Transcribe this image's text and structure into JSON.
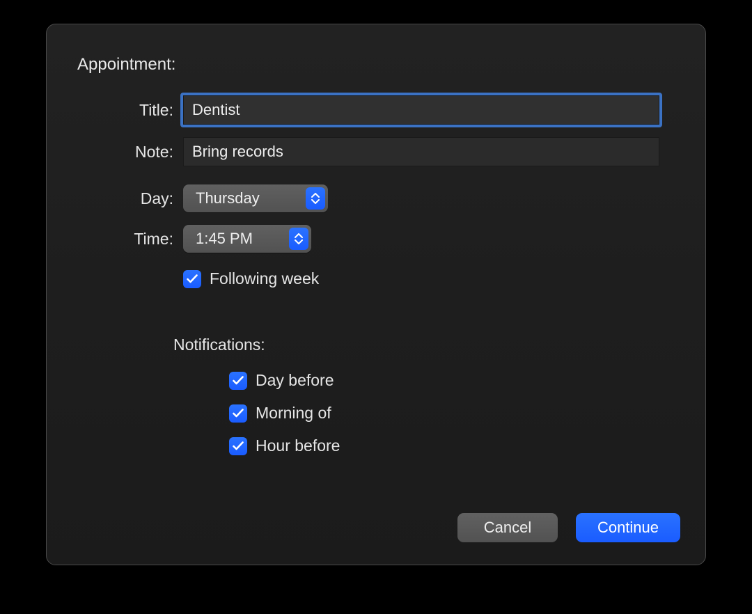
{
  "appointment": {
    "heading": "Appointment:",
    "fields": {
      "title_label": "Title:",
      "title_value": "Dentist",
      "note_label": "Note:",
      "note_value": "Bring records",
      "day_label": "Day:",
      "day_value": "Thursday",
      "time_label": "Time:",
      "time_value": "1:45 PM",
      "following_week_label": "Following week",
      "following_week_checked": true
    },
    "notifications": {
      "heading": "Notifications:",
      "items": [
        {
          "label": "Day before",
          "checked": true
        },
        {
          "label": "Morning of",
          "checked": true
        },
        {
          "label": "Hour before",
          "checked": true
        }
      ]
    }
  },
  "buttons": {
    "cancel": "Cancel",
    "continue": "Continue"
  }
}
